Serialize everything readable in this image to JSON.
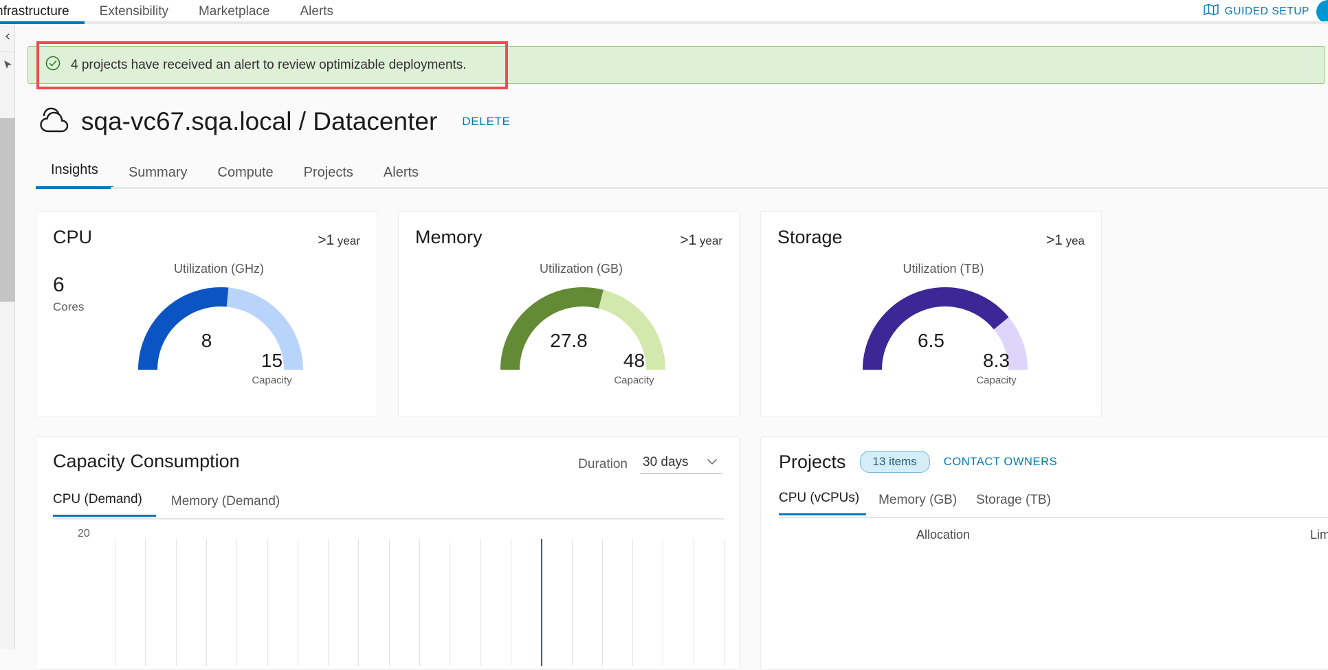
{
  "topnav": {
    "items": [
      {
        "label": "nfrastructure",
        "active": true
      },
      {
        "label": "Extensibility",
        "active": false
      },
      {
        "label": "Marketplace",
        "active": false
      },
      {
        "label": "Alerts",
        "active": false
      }
    ],
    "guided_setup": "GUIDED SETUP",
    "guided_setup_icon": "map-icon",
    "avatar_icon": "user-avatar-icon",
    "accent_color": "#0079b8"
  },
  "left_rail": {
    "collapse_icon": "chevron-collapse-icon",
    "pointer_icon": "cursor-arrow-icon"
  },
  "alert": {
    "icon": "success-check-icon",
    "message": "4 projects have received an alert to review optimizable deployments.",
    "bg_color": "#dff0d8",
    "border_color": "#9cc77e",
    "highlight_color": "#f04e4e"
  },
  "page": {
    "icon": "cloud-icon",
    "title": "sqa-vc67.sqa.local / Datacenter",
    "delete_label": "DELETE"
  },
  "tabs": [
    {
      "label": "Insights",
      "active": true
    },
    {
      "label": "Summary",
      "active": false
    },
    {
      "label": "Compute",
      "active": false
    },
    {
      "label": "Projects",
      "active": false
    },
    {
      "label": "Alerts",
      "active": false
    }
  ],
  "gauge_cards": [
    {
      "title": "CPU",
      "period": "1 year",
      "period_prefix": ">",
      "gauge_label": "Utilization (GHz)",
      "extra_num": "6",
      "extra_lbl": "Cores",
      "value": "8",
      "capacity": "15",
      "capacity_lbl": "Capacity",
      "fill_color": "#0b54c4",
      "track_color": "#b9d4fb",
      "percent": 53
    },
    {
      "title": "Memory",
      "period": "1 year",
      "period_prefix": ">",
      "gauge_label": "Utilization (GB)",
      "extra_num": "",
      "extra_lbl": "",
      "value": "27.8",
      "capacity": "48",
      "capacity_lbl": "Capacity",
      "fill_color": "#638a35",
      "track_color": "#d3e8ad",
      "percent": 58
    },
    {
      "title": "Storage",
      "period": "1 yea",
      "period_prefix": ">",
      "gauge_label": "Utilization (TB)",
      "extra_num": "",
      "extra_lbl": "",
      "value": "6.5",
      "capacity": "8.3",
      "capacity_lbl": "Capacity",
      "fill_color": "#3b2795",
      "track_color": "#ddd6fa",
      "percent": 78
    }
  ],
  "capacity": {
    "title": "Capacity Consumption",
    "duration_label": "Duration",
    "duration_value": "30 days",
    "duration_icon": "chevron-down-icon",
    "tabs": [
      {
        "label": "CPU (Demand)",
        "active": true
      },
      {
        "label": "Memory (Demand)",
        "active": false
      }
    ],
    "chart_data": {
      "type": "line",
      "title": "Capacity Consumption",
      "series": [
        {
          "name": "CPU (Demand)",
          "values": []
        }
      ],
      "ytick_labels": [
        "20"
      ],
      "ylim": [
        0,
        20
      ],
      "xlabel": "",
      "ylabel": "",
      "grid": true,
      "gridline_count": 21,
      "highlighted_gridline_index": 14,
      "highlight_color": "#2060b0"
    }
  },
  "projects": {
    "title": "Projects",
    "items_badge": "13 items",
    "contact_owners": "CONTACT OWNERS",
    "tabs": [
      {
        "label": "CPU (vCPUs)",
        "active": true
      },
      {
        "label": "Memory (GB)",
        "active": false
      },
      {
        "label": "Storage (TB)",
        "active": false
      }
    ],
    "columns": [
      "Allocation",
      "Limits"
    ]
  }
}
